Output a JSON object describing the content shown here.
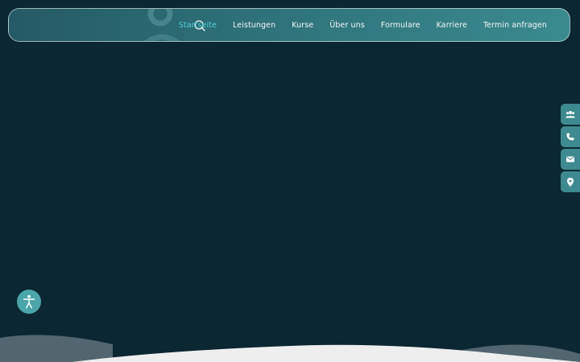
{
  "header": {
    "nav": [
      {
        "label": "Startseite",
        "active": true
      },
      {
        "label": "Leistungen",
        "active": false
      },
      {
        "label": "Kurse",
        "active": false
      },
      {
        "label": "Über uns",
        "active": false
      },
      {
        "label": "Formulare",
        "active": false
      },
      {
        "label": "Karriere",
        "active": false
      },
      {
        "label": "Termin anfragen",
        "active": false
      }
    ],
    "search_icon": "search-icon"
  },
  "side_tabs": [
    {
      "icon": "users-icon"
    },
    {
      "icon": "phone-icon"
    },
    {
      "icon": "envelope-icon"
    },
    {
      "icon": "map-marker-icon"
    }
  ],
  "accessibility": {
    "icon": "accessibility-icon"
  },
  "colors": {
    "background": "#0b2731",
    "header_start": "#245a65",
    "header_end": "#3a8a8f",
    "accent_active": "#4fd1d8",
    "side_tab": "#3d8a90",
    "a11y_button": "#4aa6aa",
    "wave_light": "#eeeeee",
    "wave_mid": "#8c9aa0"
  }
}
